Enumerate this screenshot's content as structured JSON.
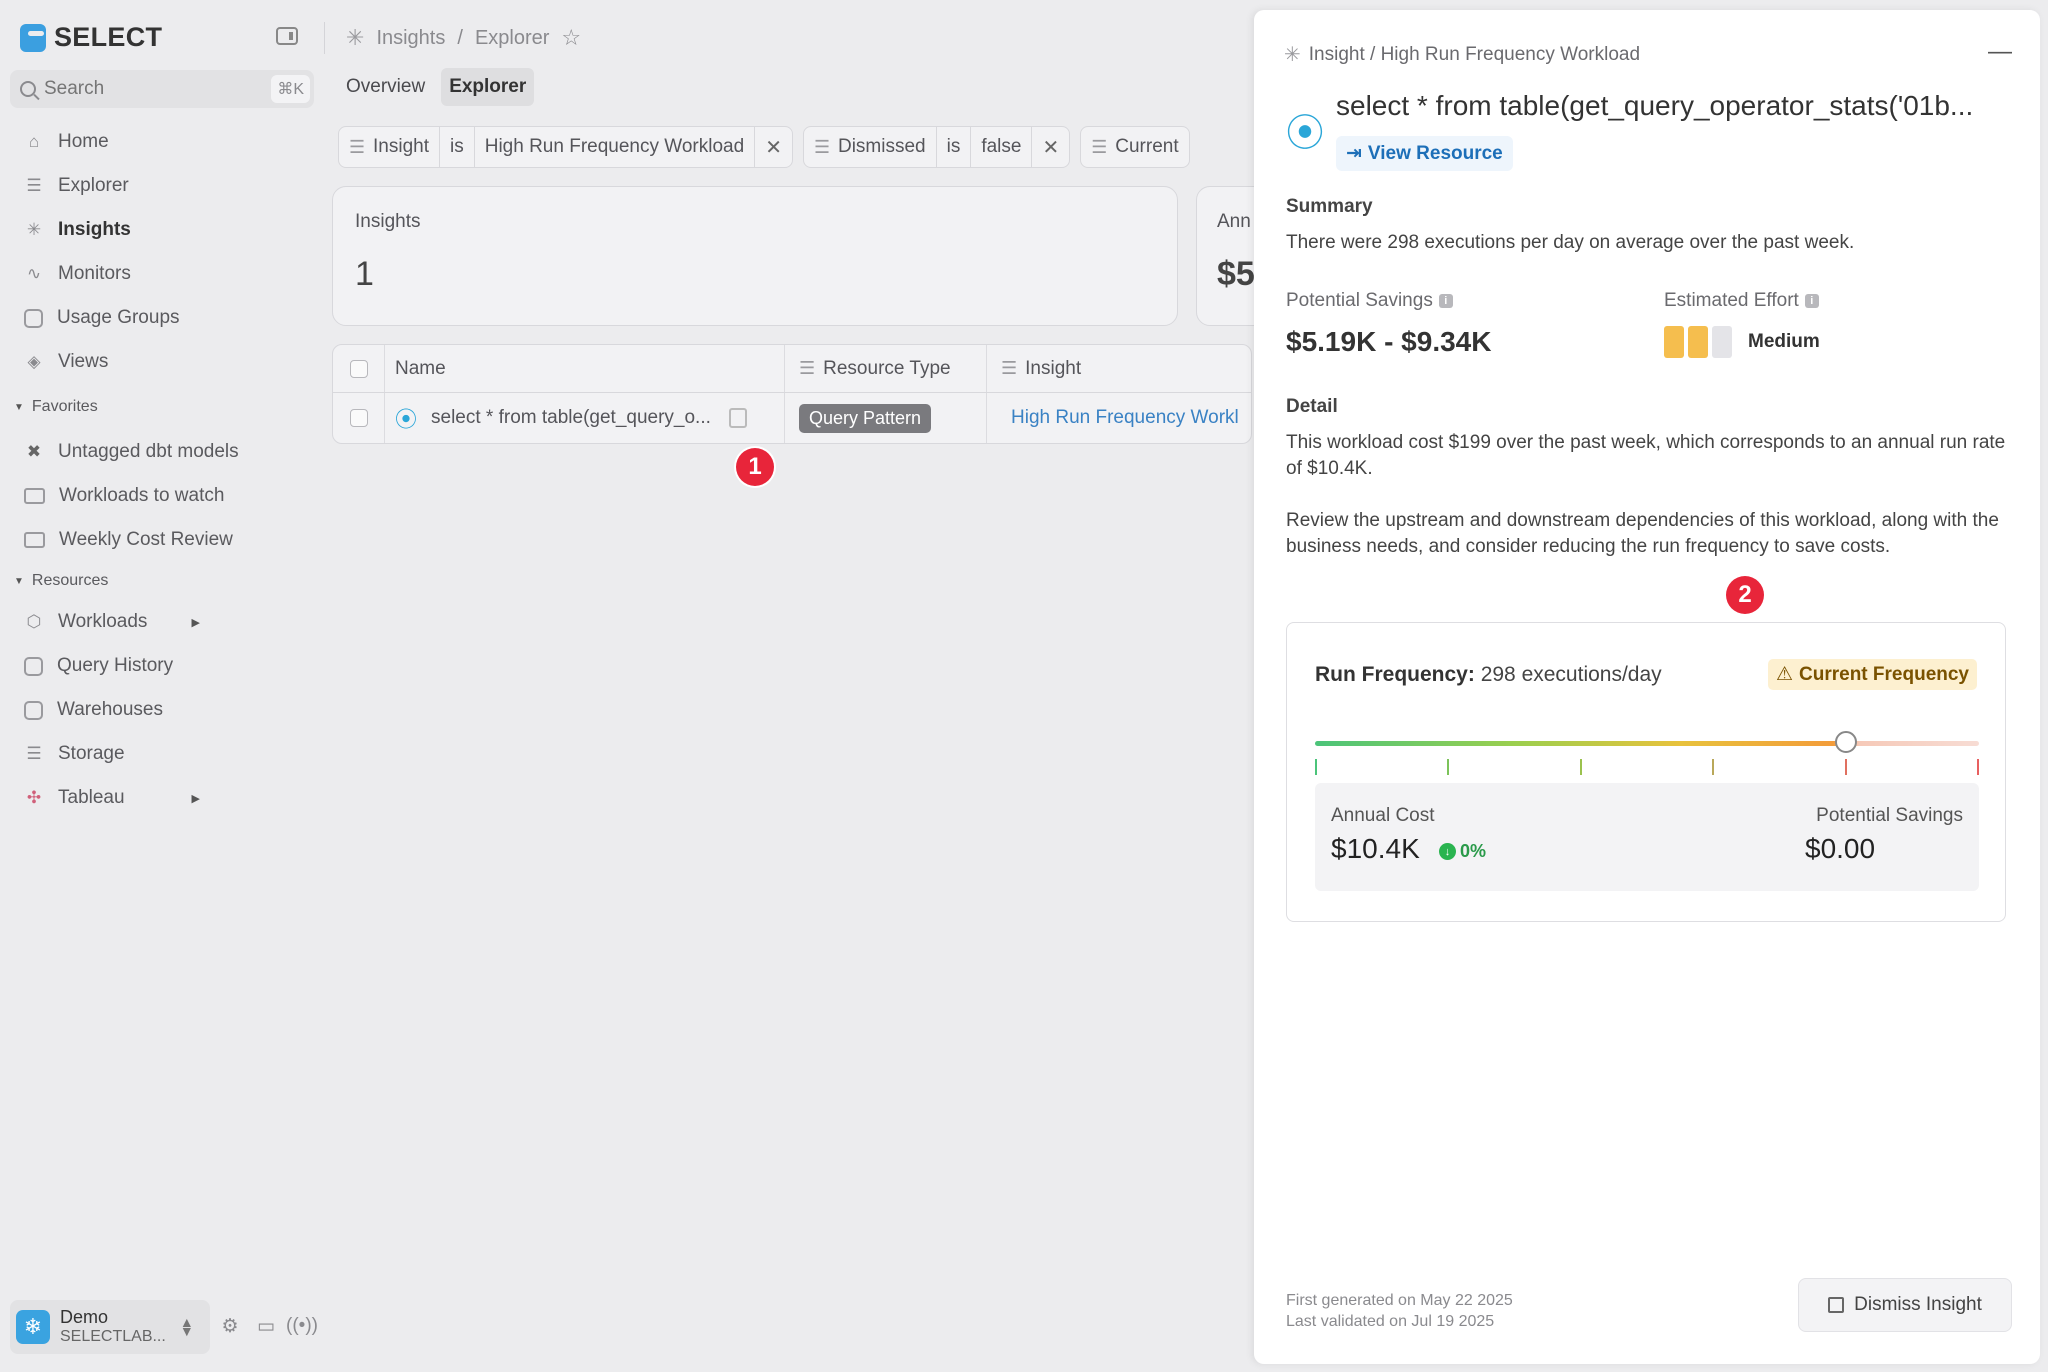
{
  "app": {
    "name": "SELECT",
    "search_placeholder": "Search",
    "search_shortcut": "⌘K"
  },
  "sidebar": {
    "nav": [
      {
        "label": "Home",
        "icon": "home-icon"
      },
      {
        "label": "Explorer",
        "icon": "explorer-icon"
      },
      {
        "label": "Insights",
        "icon": "insights-icon",
        "active": true
      },
      {
        "label": "Monitors",
        "icon": "monitors-icon"
      },
      {
        "label": "Usage Groups",
        "icon": "usage-groups-icon"
      },
      {
        "label": "Views",
        "icon": "views-icon"
      }
    ],
    "favorites_header": "Favorites",
    "favorites": [
      {
        "label": "Untagged dbt models",
        "icon": "dbt-icon"
      },
      {
        "label": "Workloads to watch",
        "icon": "folder-icon"
      },
      {
        "label": "Weekly Cost Review",
        "icon": "folder-icon"
      }
    ],
    "resources_header": "Resources",
    "resources": [
      {
        "label": "Workloads",
        "icon": "cube-icon",
        "expandable": true
      },
      {
        "label": "Query History",
        "icon": "query-history-icon"
      },
      {
        "label": "Warehouses",
        "icon": "warehouse-icon"
      },
      {
        "label": "Storage",
        "icon": "database-icon"
      },
      {
        "label": "Tableau",
        "icon": "tableau-icon",
        "expandable": true
      }
    ],
    "account": {
      "name": "Demo",
      "sub": "SELECTLAB..."
    }
  },
  "breadcrumb": {
    "first": "Insights",
    "sep": "/",
    "second": "Explorer"
  },
  "tabs": [
    "Overview",
    "Explorer"
  ],
  "active_tab": "Explorer",
  "filters": [
    {
      "field": "Insight",
      "op": "is",
      "value": "High Run Frequency Workload"
    },
    {
      "field": "Dismissed",
      "op": "is",
      "value": "false"
    },
    {
      "field": "Current"
    }
  ],
  "cards": [
    {
      "label": "Insights",
      "value": "1"
    },
    {
      "label": "Ann",
      "value": "$5"
    }
  ],
  "table": {
    "columns": [
      "Name",
      "Resource Type",
      "Insight"
    ],
    "rows": [
      {
        "name": "select * from table(get_query_o...",
        "resource_type": "Query Pattern",
        "insight": "High Run Frequency Workl"
      }
    ]
  },
  "annotations": {
    "one": "1",
    "two": "2"
  },
  "drawer": {
    "crumb": "Insight / High Run Frequency Workload",
    "title": "select * from table(get_query_operator_stats('01b...",
    "view_resource": "View Resource",
    "summary_header": "Summary",
    "summary": "There were 298 executions per day on average over the past week.",
    "potential_savings_label": "Potential Savings",
    "potential_savings_value": "$5.19K - $9.34K",
    "estimated_effort_label": "Estimated Effort",
    "estimated_effort_value": "Medium",
    "estimated_effort_level": 2,
    "estimated_effort_max": 3,
    "detail_header": "Detail",
    "detail_p1": "This workload cost $199 over the past week, which corresponds to an annual run rate of $10.4K.",
    "detail_p2": "Review the upstream and downstream dependencies of this workload, along with the business needs, and consider reducing the run frequency to save costs.",
    "run_frequency_label": "Run Frequency:",
    "run_frequency_value": "298 executions/day",
    "frequency_badge": "Current Frequency",
    "slider_position_fraction": 0.8,
    "annual_cost_label": "Annual Cost",
    "annual_cost_value": "$10.4K",
    "annual_cost_change": "0%",
    "potential_savings_panel_label": "Potential Savings",
    "potential_savings_panel_value": "$0.00",
    "first_generated": "First generated on May 22 2025",
    "last_validated": "Last validated on Jul 19 2025",
    "dismiss_label": "Dismiss Insight"
  },
  "colors": {
    "accent_blue": "#3b9fe0",
    "link_blue": "#1d6fb8",
    "badge_red": "#e8253a",
    "warning_bg": "#fdf0d0",
    "effort_fill": "#f5be4e",
    "effort_empty": "#e4e4e8"
  }
}
